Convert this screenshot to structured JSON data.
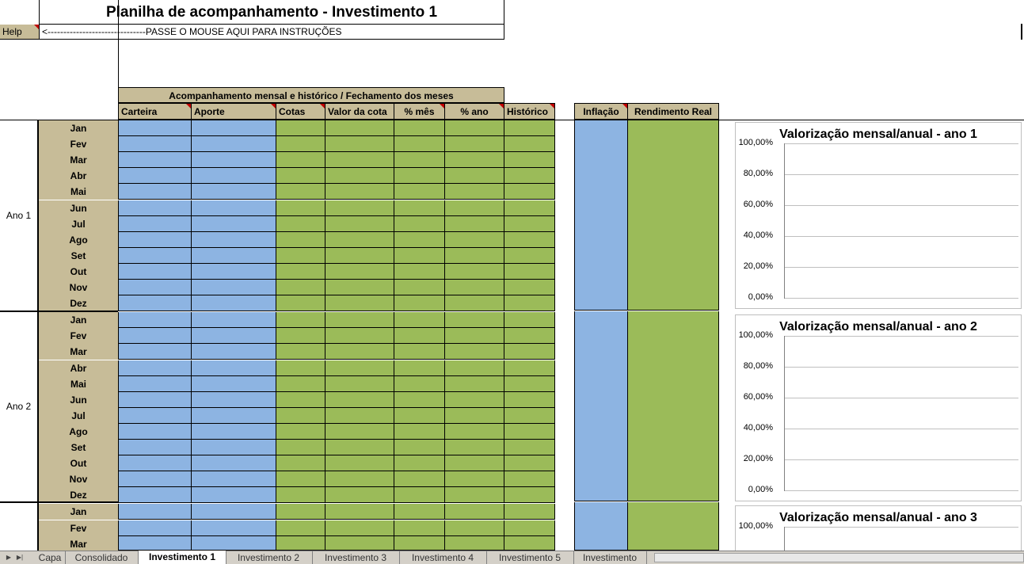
{
  "sheet": {
    "title": "Planilha de acompanhamento - Investimento 1",
    "help_label": "Help",
    "help_hint": "<-------------------------------PASSE O MOUSE AQUI PARA INSTRUÇÕES"
  },
  "table": {
    "group_header": "Acompanhamento mensal e histórico / Fechamento dos meses",
    "columns": {
      "carteira": "Carteira",
      "aporte": "Aporte",
      "cotas": "Cotas",
      "valor_cota": "Valor da cota",
      "pct_mes": "% mês",
      "pct_ano": "% ano",
      "historico": "Histórico",
      "inflacao": "Inflação",
      "rendimento_real": "Rendimento Real"
    },
    "months": [
      "Jan",
      "Fev",
      "Mar",
      "Abr",
      "Mai",
      "Jun",
      "Jul",
      "Ago",
      "Set",
      "Out",
      "Nov",
      "Dez"
    ],
    "years": [
      "Ano 1",
      "Ano 2"
    ]
  },
  "charts": [
    {
      "title": "Valorização mensal/anual  - ano 1",
      "ticks": [
        "100,00%",
        "80,00%",
        "60,00%",
        "40,00%",
        "20,00%",
        "0,00%"
      ]
    },
    {
      "title": "Valorização mensal/anual  - ano 2",
      "ticks": [
        "100,00%",
        "80,00%",
        "60,00%",
        "40,00%",
        "20,00%",
        "0,00%"
      ]
    },
    {
      "title": "Valorização mensal/anual  - ano 3",
      "ticks": [
        "100,00%"
      ]
    }
  ],
  "tabs": [
    "Capa",
    "Consolidado",
    "Investimento 1",
    "Investimento 2",
    "Investimento 3",
    "Investimento 4",
    "Investimento 5",
    "Investimento"
  ],
  "active_tab": "Investimento 1",
  "colors": {
    "tan": "#c7bc98",
    "blue": "#8db4e2",
    "green": "#9bbb59",
    "comment_marker": "#c00000"
  }
}
